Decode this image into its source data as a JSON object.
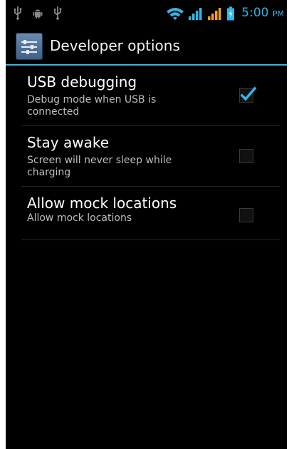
{
  "status_bar": {
    "time": "5:00",
    "ampm": "PM",
    "left_icons": [
      "usb-icon",
      "android-debug-icon",
      "usb-icon"
    ],
    "right_icons": [
      "wifi-icon",
      "signal-icon",
      "signal-icon",
      "battery-charging-icon"
    ],
    "accent_color": "#33b5e5"
  },
  "action_bar": {
    "icon": "settings-app-icon",
    "title": "Developer options"
  },
  "preferences": [
    {
      "title": "USB debugging",
      "summary": "Debug mode when USB is connected",
      "checked": true
    },
    {
      "title": "Stay awake",
      "summary": "Screen will never sleep while charging",
      "checked": false
    },
    {
      "title": "Allow mock locations",
      "summary": "Allow mock locations",
      "checked": false
    }
  ]
}
